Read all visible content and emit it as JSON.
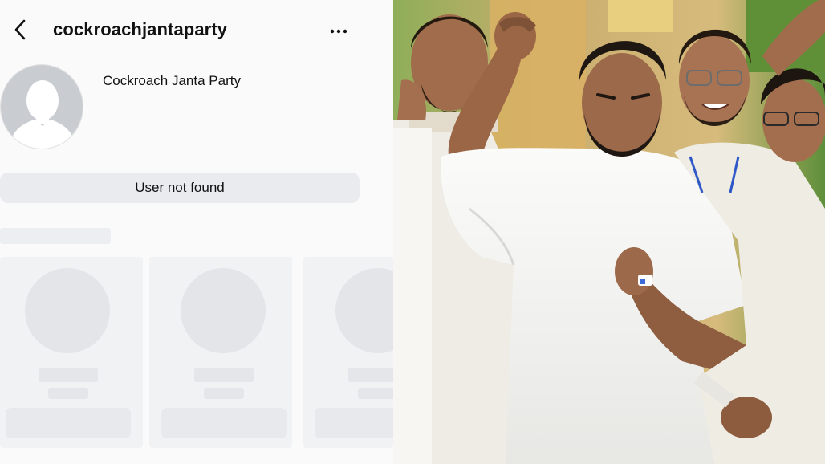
{
  "profile": {
    "username": "cockroachjantaparty",
    "full_name": "Cockroach Janta Party",
    "status_message": "User not found",
    "avatar": "default-silhouette",
    "icons": {
      "back": "chevron-left-icon",
      "more": "more-horizontal-icon"
    }
  },
  "suggestions": {
    "state": "loading-placeholders",
    "visible_cards": 3
  },
  "photo": {
    "description_free": true,
    "dominant_colors": {
      "shirt": "#f4f4f2",
      "skin": "#9c6a4a",
      "hair": "#1f1712",
      "background": "#c8b07a",
      "foliage": "#6f9a3e"
    }
  }
}
